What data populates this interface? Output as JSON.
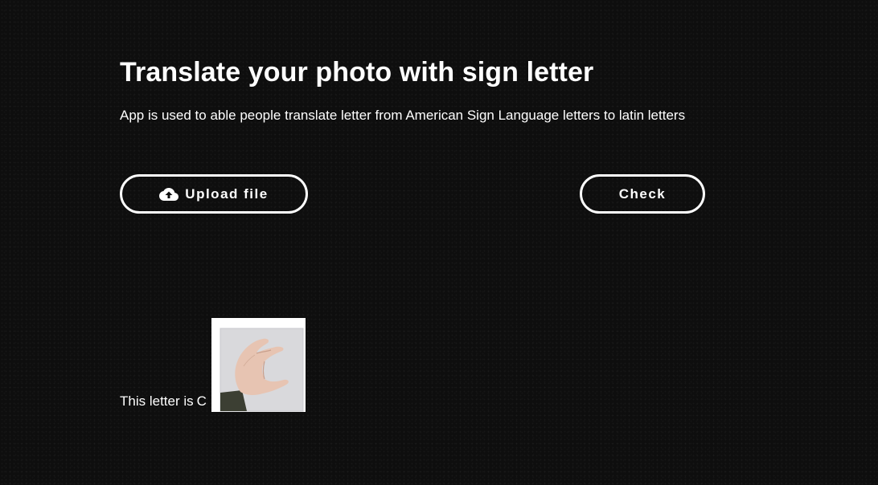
{
  "header": {
    "title": "Translate your photo with sign letter",
    "description": "App is used to able people translate letter from American Sign Language letters to latin letters"
  },
  "actions": {
    "upload_label": "Upload file",
    "upload_icon": "cloud-upload-icon",
    "check_label": "Check"
  },
  "result": {
    "prefix": "This letter is",
    "letter": "C",
    "image_alt": "Hand sign for letter C"
  },
  "colors": {
    "background": "#0e0e0e",
    "text": "#ffffff",
    "button_border": "#ffffff"
  }
}
